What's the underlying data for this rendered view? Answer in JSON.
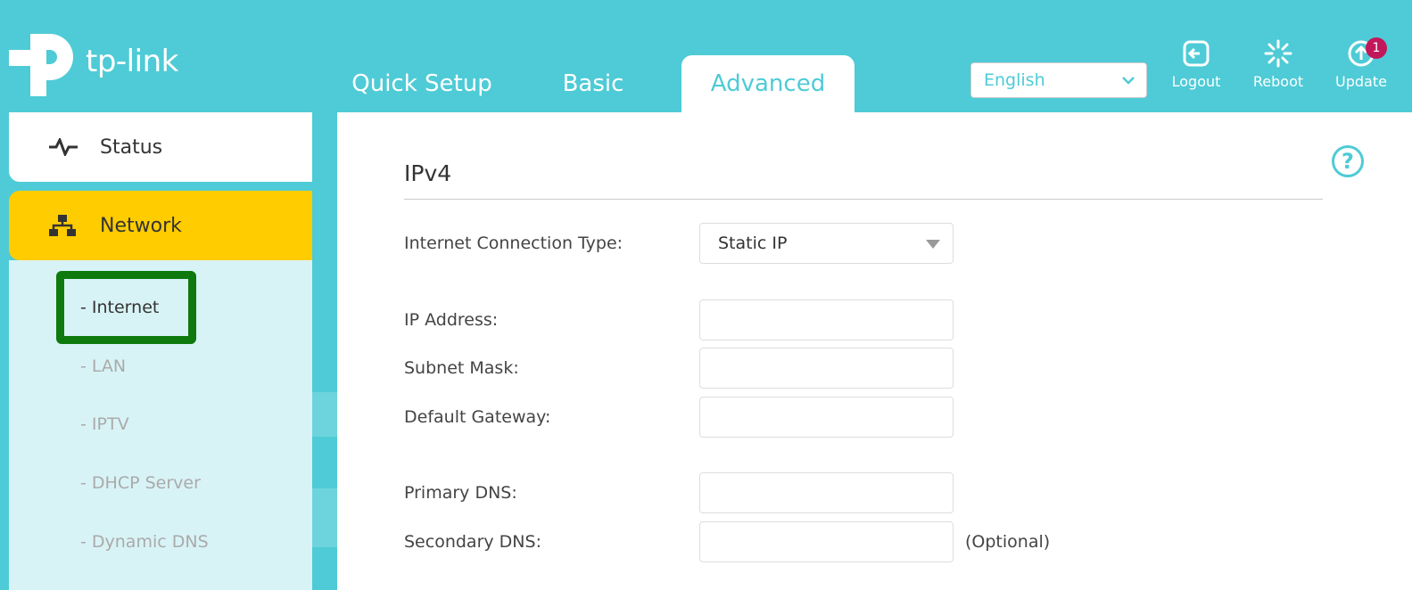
{
  "brand": {
    "logo_text": "tp-link"
  },
  "tabs": [
    {
      "label": "Quick Setup",
      "active": false
    },
    {
      "label": "Basic",
      "active": false
    },
    {
      "label": "Advanced",
      "active": true
    }
  ],
  "header": {
    "language": "English",
    "logout_label": "Logout",
    "reboot_label": "Reboot",
    "update_label": "Update",
    "update_badge": "1"
  },
  "sidebar": {
    "status_label": "Status",
    "network_label": "Network",
    "sub_items": [
      {
        "label": "- Internet",
        "active": true
      },
      {
        "label": "- LAN",
        "active": false
      },
      {
        "label": "- IPTV",
        "active": false
      },
      {
        "label": "- DHCP Server",
        "active": false
      },
      {
        "label": "- Dynamic DNS",
        "active": false
      }
    ]
  },
  "main": {
    "section_title": "IPv4",
    "help_icon": "?",
    "connection_type_label": "Internet Connection Type:",
    "connection_type_value": "Static IP",
    "fields": [
      {
        "label": "IP Address:",
        "value": ""
      },
      {
        "label": "Subnet Mask:",
        "value": ""
      },
      {
        "label": "Default Gateway:",
        "value": ""
      },
      {
        "label": "Primary DNS:",
        "value": ""
      },
      {
        "label": "Secondary DNS:",
        "value": ""
      }
    ],
    "optional_note": "(Optional)"
  },
  "colors": {
    "accent": "#4ecbd6",
    "network_highlight": "#ffcc00",
    "selection_box": "#0e7a0e",
    "badge": "#c2185b"
  }
}
